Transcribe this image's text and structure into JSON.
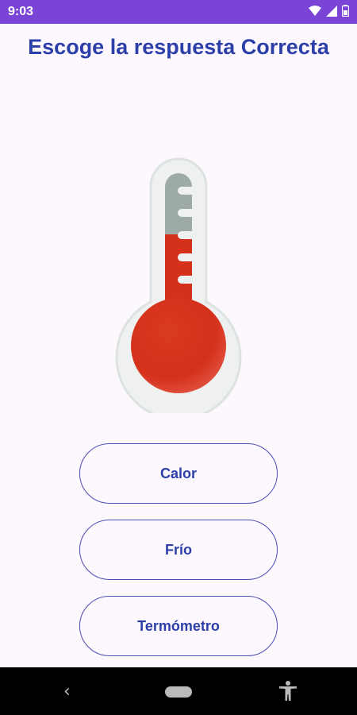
{
  "status_bar": {
    "time": "9:03",
    "icons": [
      "wifi-icon",
      "signal-icon",
      "battery-icon"
    ],
    "color": "#7a45d6"
  },
  "title": "Escoge la respuesta Correcta",
  "image": {
    "icon": "thermometer-icon",
    "fill_fraction": 0.6
  },
  "options": [
    {
      "label": "Calor"
    },
    {
      "label": "Frío"
    },
    {
      "label": "Termómetro"
    }
  ],
  "nav_bar": {
    "icons": [
      "back-icon",
      "home-icon",
      "accessibility-icon"
    ]
  },
  "colors": {
    "accent": "#2c3ea7",
    "button_border": "#4a4ab3",
    "background": "#fdf8fd"
  }
}
